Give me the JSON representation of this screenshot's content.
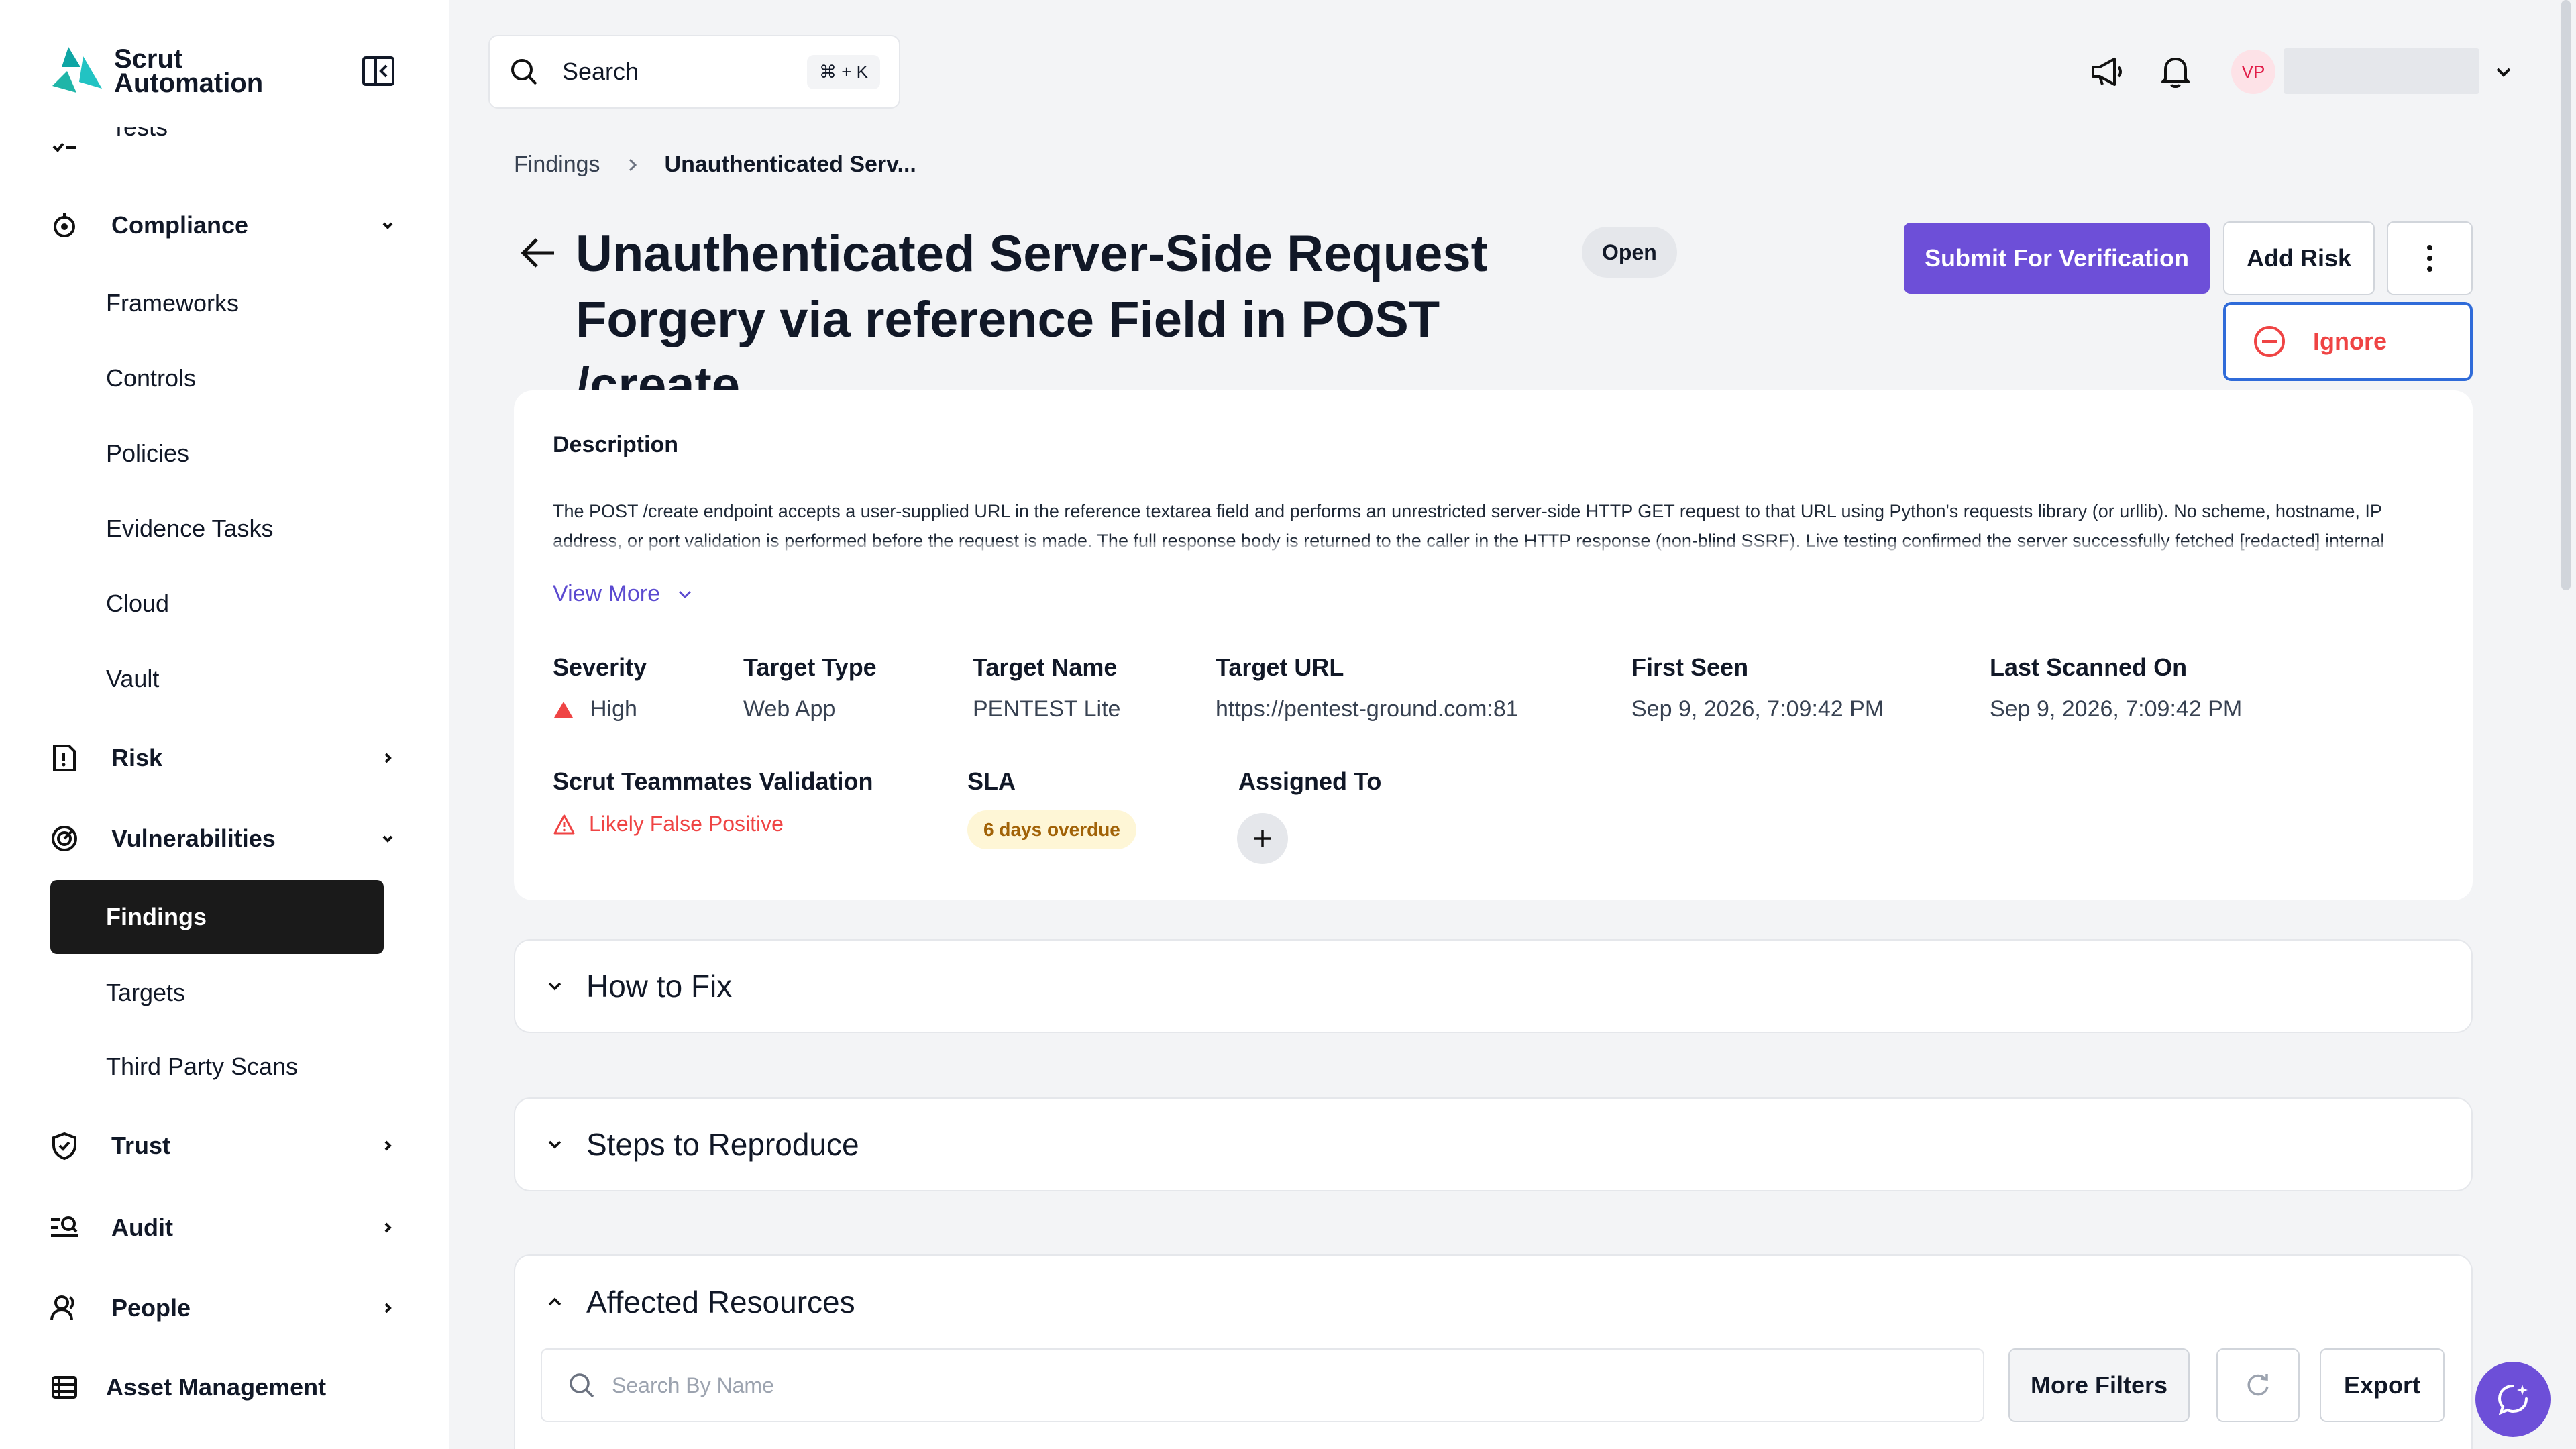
{
  "brand": {
    "line1": "Scrut",
    "line2": "Automation"
  },
  "sidebar": {
    "partial_item": "Tests",
    "compliance": "Compliance",
    "compliance_items": [
      "Frameworks",
      "Controls",
      "Policies",
      "Evidence Tasks",
      "Cloud",
      "Vault"
    ],
    "risk": "Risk",
    "vulnerabilities": "Vulnerabilities",
    "findings": "Findings",
    "targets": "Targets",
    "third_party": "Third Party Scans",
    "trust": "Trust",
    "audit": "Audit",
    "people": "People",
    "asset_management": "Asset Management"
  },
  "topbar": {
    "search_label": "Search",
    "search_shortcut": "⌘ + K",
    "avatar_initials": "VP"
  },
  "breadcrumb": {
    "root": "Findings",
    "current": "Unauthenticated Serv..."
  },
  "finding": {
    "title": "Unauthenticated Server-Side Request Forgery via reference Field in POST /create",
    "status": "Open",
    "submit_label": "Submit For Verification",
    "add_risk_label": "Add Risk",
    "ignore_label": "Ignore",
    "description_heading": "Description",
    "description_text": "The POST /create endpoint accepts a user-supplied URL in the reference textarea field and performs an unrestricted server-side HTTP GET request to that URL using Python's requests library (or urllib). No scheme, hostname, IP address, or port validation is performed before the request is made. The full response body is returned to the caller in the HTTP response (non-blind SSRF). Live testing confirmed the server successfully fetched [redacted] internal metadata endpoints including the cloud provider IMDS and returned the complete content to the requester.",
    "view_more": "View More",
    "fields": {
      "severity_label": "Severity",
      "severity": "High",
      "target_type_label": "Target Type",
      "target_type": "Web App",
      "target_name_label": "Target Name",
      "target_name": "PENTEST Lite",
      "target_url_label": "Target URL",
      "target_url": "https://pentest-ground.com:81",
      "first_seen_label": "First Seen",
      "first_seen": "Sep 9, 2026, 7:09:42 PM",
      "last_scanned_label": "Last Scanned On",
      "last_scanned": "Sep 9, 2026, 7:09:42 PM",
      "validation_label": "Scrut Teammates Validation",
      "validation": "Likely False Positive",
      "sla_label": "SLA",
      "sla": "6 days overdue",
      "assigned_label": "Assigned To"
    }
  },
  "sections": {
    "how_to_fix": "How to Fix",
    "steps": "Steps to Reproduce",
    "affected": "Affected Resources"
  },
  "resources": {
    "search_placeholder": "Search By Name",
    "more_filters": "More Filters",
    "export": "Export"
  },
  "colors": {
    "primary": "#6d4fd8",
    "danger": "#ef4444",
    "sla_bg": "#fef6d6",
    "sla_text": "#a16207",
    "active_nav": "#1a1a1a"
  }
}
